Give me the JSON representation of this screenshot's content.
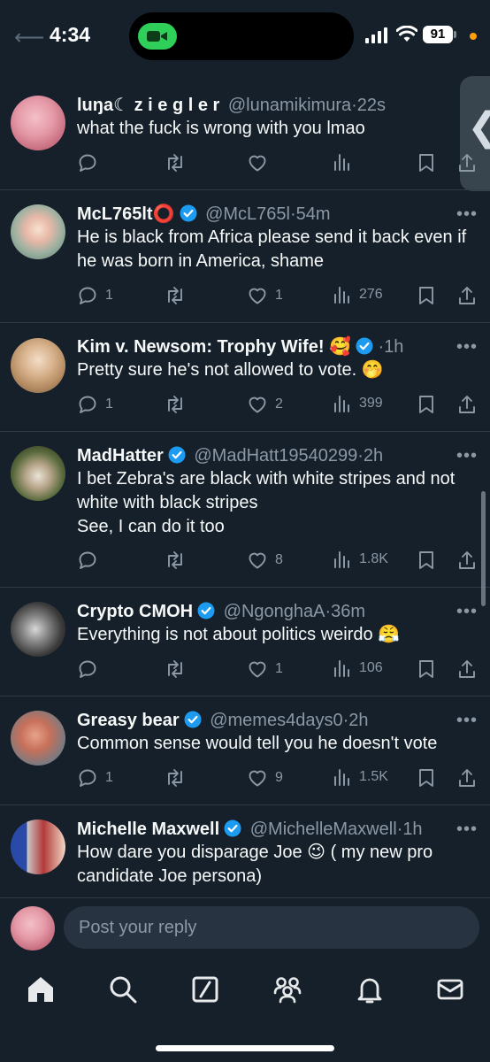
{
  "status_bar": {
    "time": "4:34",
    "battery": "91"
  },
  "tweets": [
    {
      "name": "luŋa☾ z i e g l e r",
      "handle": "@lunamikimura",
      "time": "22s",
      "verified": false,
      "text": "what the fuck is wrong with you lmao",
      "replies": "",
      "likes": "",
      "views": ""
    },
    {
      "name": "McL765lt⭕",
      "handle": "@McL765l",
      "time": "54m",
      "verified": true,
      "text": "He is black from Africa please send it back even if he was born in America, shame",
      "replies": "1",
      "likes": "1",
      "views": "276"
    },
    {
      "name": "Kim v. Newsom: Trophy Wife! 🥰",
      "handle": "",
      "time": "1h",
      "verified": true,
      "text": "Pretty sure he's not allowed to vote. 🤭",
      "replies": "1",
      "likes": "2",
      "views": "399"
    },
    {
      "name": "MadHatter",
      "handle": "@MadHatt19540299",
      "time": "2h",
      "verified": true,
      "text": "I bet Zebra's are black with white stripes and not white with black stripes\nSee, I can do it too",
      "replies": "",
      "likes": "8",
      "views": "1.8K"
    },
    {
      "name": "Crypto CMOH",
      "handle": "@NgonghaA",
      "time": "36m",
      "verified": true,
      "text": "Everything is not about politics weirdo 😤",
      "replies": "",
      "likes": "1",
      "views": "106"
    },
    {
      "name": "Greasy bear",
      "handle": "@memes4days0",
      "time": "2h",
      "verified": true,
      "text": "Common sense would tell you he doesn't vote",
      "replies": "1",
      "likes": "9",
      "views": "1.5K"
    },
    {
      "name": "Michelle Maxwell",
      "handle": "@MichelleMaxwell",
      "time": "1h",
      "verified": true,
      "text": "How dare you disparage Joe 😉 ( my new pro candidate Joe persona)",
      "replies": "",
      "likes": "",
      "views": ""
    }
  ],
  "reply_bar": {
    "placeholder": "Post your reply"
  },
  "colors": {
    "background": "#15202b",
    "verified": "#1d9bf0",
    "secondary_text": "#8b98a5",
    "divider": "#2f3b47"
  },
  "tabbar": {
    "icons": [
      "home-icon",
      "search-icon",
      "grok-icon",
      "communities-icon",
      "notifications-icon",
      "messages-icon"
    ]
  }
}
